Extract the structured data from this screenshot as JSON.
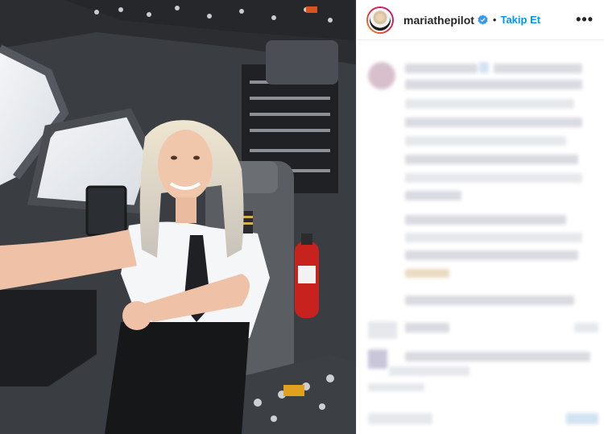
{
  "post": {
    "username": "mariathepilot",
    "separator": "•",
    "follow_label": "Takip Et",
    "more_glyph": "•••"
  },
  "icons": {
    "verified": "verified-badge-icon",
    "more": "more-options-icon"
  },
  "colors": {
    "follow": "#0095f6",
    "verified": "#3897f0",
    "text": "#262626"
  }
}
